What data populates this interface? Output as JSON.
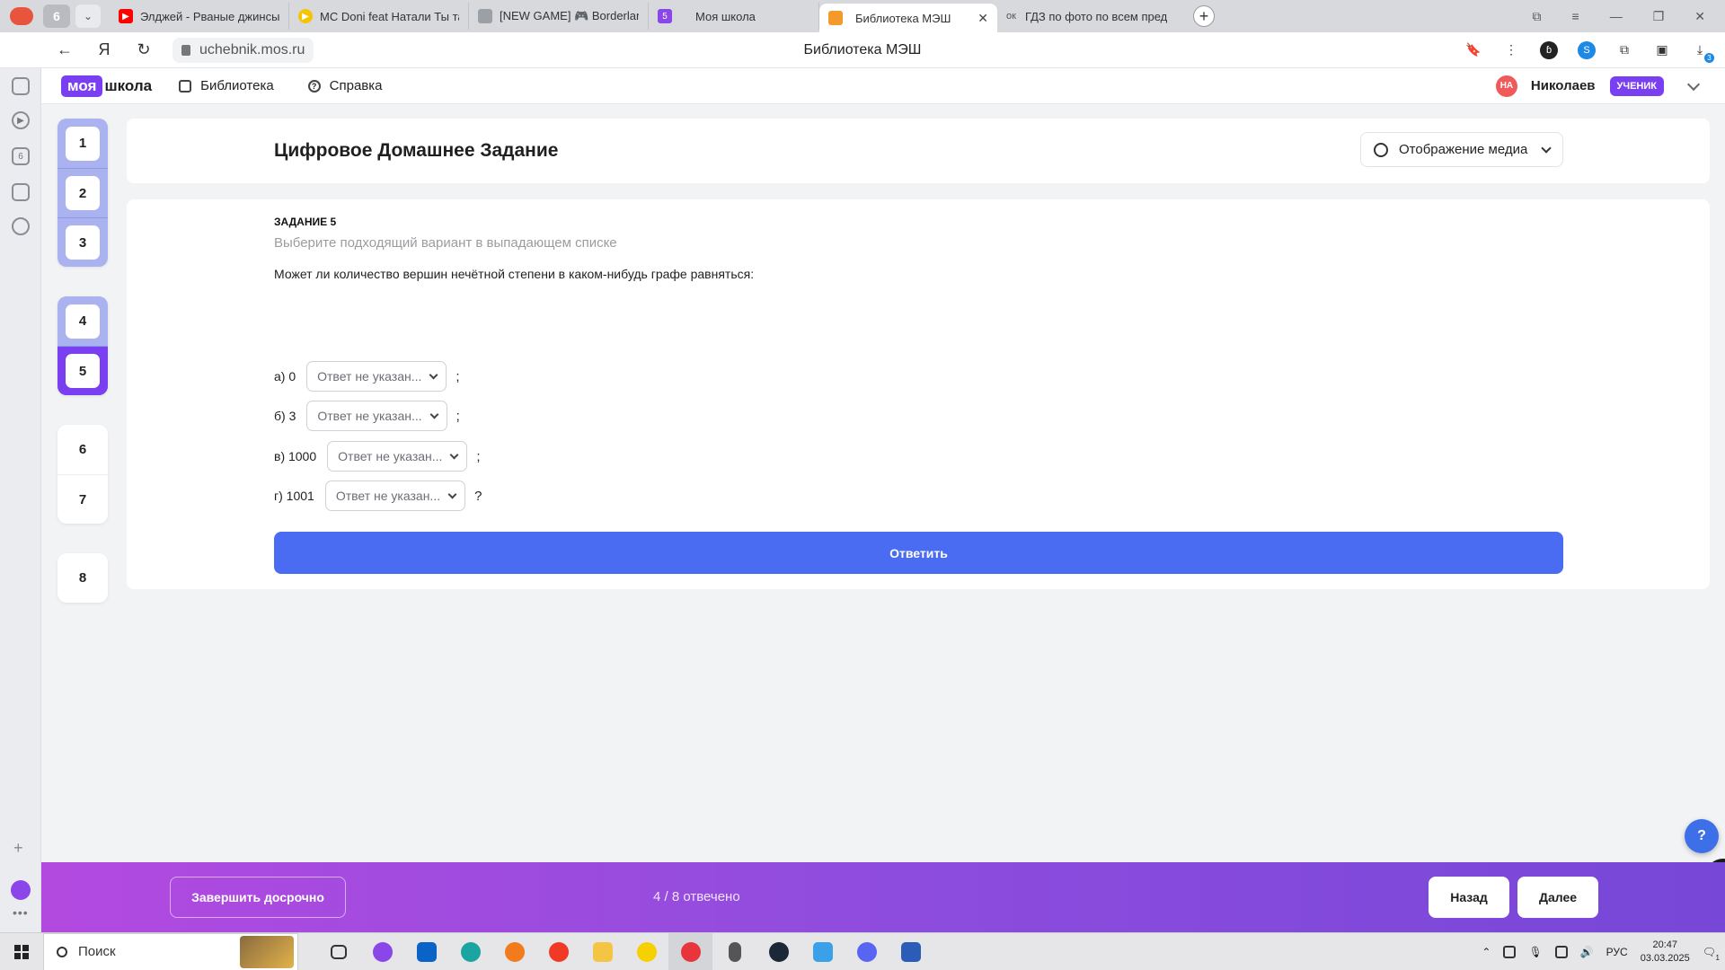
{
  "browser": {
    "group_count": "6",
    "tabs": [
      {
        "title": "Элджей - Рваные джинсы",
        "color": "#ff0000"
      },
      {
        "title": "MC Doni feat Натали Ты так",
        "color": "#f5c400"
      },
      {
        "title": "[NEW GAME] 🎮 Borderlands",
        "color": "#9aa0a6"
      },
      {
        "title": "Моя школа",
        "color": "#8a46e8"
      },
      {
        "title": "Библиотека МЭШ",
        "color": "#f39a2b"
      },
      {
        "title": "ГДЗ по фото по всем пред",
        "color": "#bbbbbb"
      }
    ],
    "tab_prefix_gdz": "ок",
    "school_badge": "5",
    "url": "uchebnik.mos.ru",
    "page_title": "Библиотека МЭШ",
    "download_badge": "3"
  },
  "header": {
    "logo_part1": "моя",
    "logo_part2": "школа",
    "nav_library": "Библиотека",
    "nav_help": "Справка",
    "avatar_initials": "НА",
    "user_name": "Николаев",
    "role": "УЧЕНИК"
  },
  "question_nav": {
    "group1": [
      "1",
      "2",
      "3"
    ],
    "group2": [
      "4",
      "5"
    ],
    "group3": [
      "6",
      "7"
    ],
    "group4": [
      "8"
    ],
    "current": "5"
  },
  "homework": {
    "title": "Цифровое Домашнее Задание",
    "media_button": "Отображение медиа"
  },
  "task": {
    "number_label": "ЗАДАНИЕ 5",
    "hint": "Выберите подходящий вариант в выпадающем списке",
    "question": "Может ли количество вершин нечётной степени в каком-нибудь графе равняться:",
    "answers": [
      {
        "label": "а) 0",
        "placeholder": "Ответ не указан...",
        "end": ";"
      },
      {
        "label": "б) 3",
        "placeholder": "Ответ не указан...",
        "end": ";"
      },
      {
        "label": "в) 1000",
        "placeholder": "Ответ не указан...",
        "end": ";"
      },
      {
        "label": "г) 1001",
        "placeholder": "Ответ не указан...",
        "end": "?"
      }
    ],
    "submit": "Ответить"
  },
  "footer": {
    "finish_early": "Завершить досрочно",
    "progress": "4 / 8 отвечено",
    "back": "Назад",
    "next": "Далее"
  },
  "help_fab": "?",
  "taskbar": {
    "search_placeholder": "Поиск",
    "lang": "РУС",
    "time": "20:47",
    "date": "03.03.2025",
    "notifications": "1"
  }
}
